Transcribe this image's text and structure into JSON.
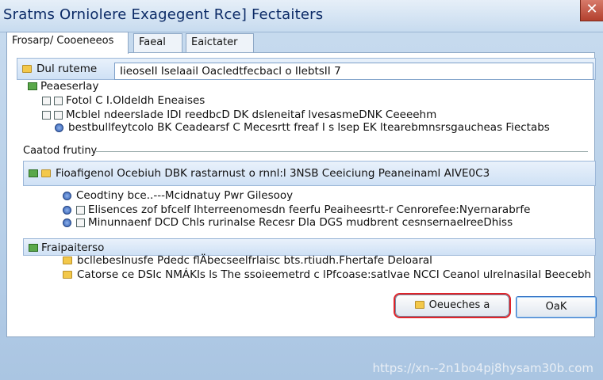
{
  "window": {
    "title": "Sratms Orniolere Exagegent Rce] Fectaiters",
    "close_glyph": "✕"
  },
  "tabs": [
    {
      "label": "Frosarp/ Cooeneeos"
    },
    {
      "label": "Faeal"
    },
    {
      "label": "Eaictater"
    }
  ],
  "name_row": {
    "label": "Dul ruteme",
    "value": "IieoseII Iselaail Oacledtfecbacl o IlebtsII 7"
  },
  "section1": {
    "header": "Peaeserlay",
    "items": [
      "Fotol C I.Oldeldh Eneaises",
      "Mcblel ndeerslade IDI reedbcD DK dsleneitaf lvesasmeDNK Ceeeehm",
      "bestbullfeytcolo BK Ceadearsf C Mecesrtt freaf I s lsep EK ltearebmnsrsgaucheas Fiectabs"
    ]
  },
  "group1": {
    "label": "Caatod frutiny",
    "header": "Fioafigenol Ocebiuh DBK rastarnust o rnnl:l 3NSB Ceeiciung Peaneinaml AIVE0C3",
    "items": [
      "Ceodtiny bce..---Mcidnatuy Pwr Gilesooy",
      "Elisences zof bfcelf lhterreenomesdn feerfu Peaiheesrtt-r Cenrorefee:Nyernarabrfe",
      "Minunnaenf DCD Chls rurinalse Recesr Dla DGS mudbrent cesnsernaelreeDhiss"
    ]
  },
  "group2": {
    "label": "Fraipaiterso",
    "items": [
      "bcllebeslnusfe Pdedc flÄbecseelfrlaisc bts.rtiudh.Fhertafe Deloaral",
      "Catorse ce DSIc NMÁKIs ls The ssoieemetrd c lPfcoase:satlvae NCCI Ceanol ulreInasilal Beecebh"
    ]
  },
  "buttons": {
    "cancel": "Oeueches a",
    "ok": "OaK"
  },
  "watermark": "https://xn--2n1bo4pj8hysam30b.com"
}
